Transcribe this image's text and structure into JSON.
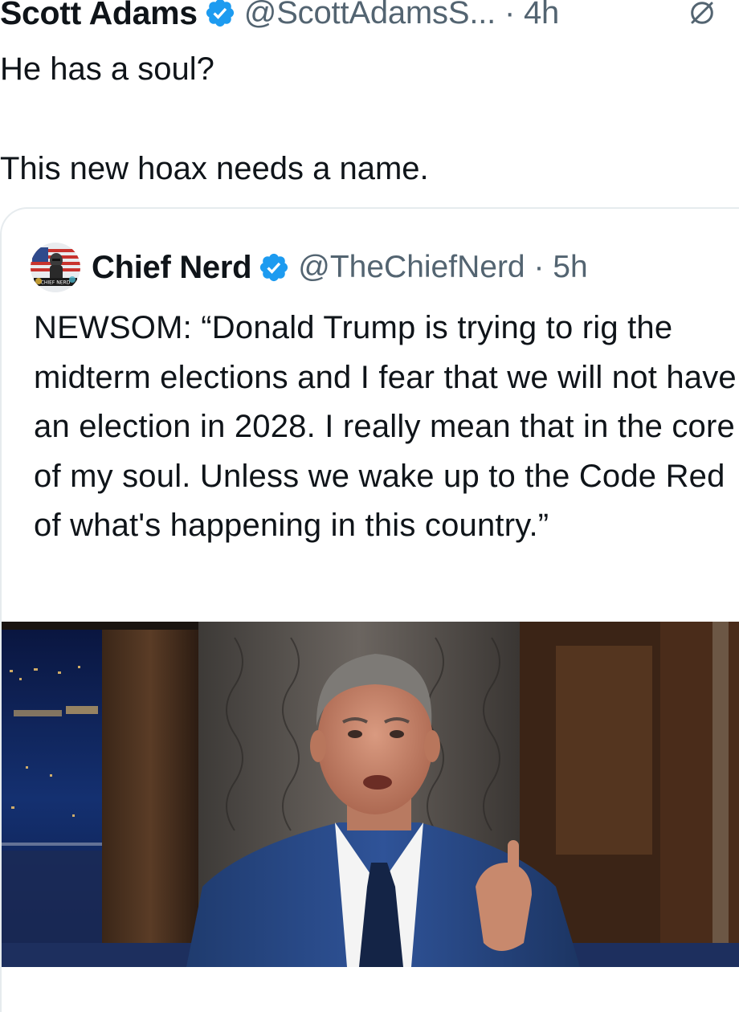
{
  "post": {
    "author_name": "Scott Adams",
    "handle_time": "@ScottAdamsS... · 4h",
    "text_line1": "He has a soul?",
    "text_line2": "This new hoax needs a name."
  },
  "quote": {
    "author_name": "Chief Nerd",
    "handle_time": "@TheChiefNerd · 5h",
    "avatar_label": "CHIEF NERD",
    "text": "NEWSOM: “Donald Trump is trying to rig the midterm elections and I fear that we will not have an election in 2028. I really mean that in the core of my soul. Unless we wake up to the Code Red of what's happening in this country.”"
  },
  "icons": {
    "verified": "verified-badge-icon",
    "grok": "grok-icon"
  },
  "colors": {
    "text": "#0f1419",
    "secondary": "#536471",
    "verified_blue": "#1d9bf0",
    "border": "#e6ebee"
  }
}
